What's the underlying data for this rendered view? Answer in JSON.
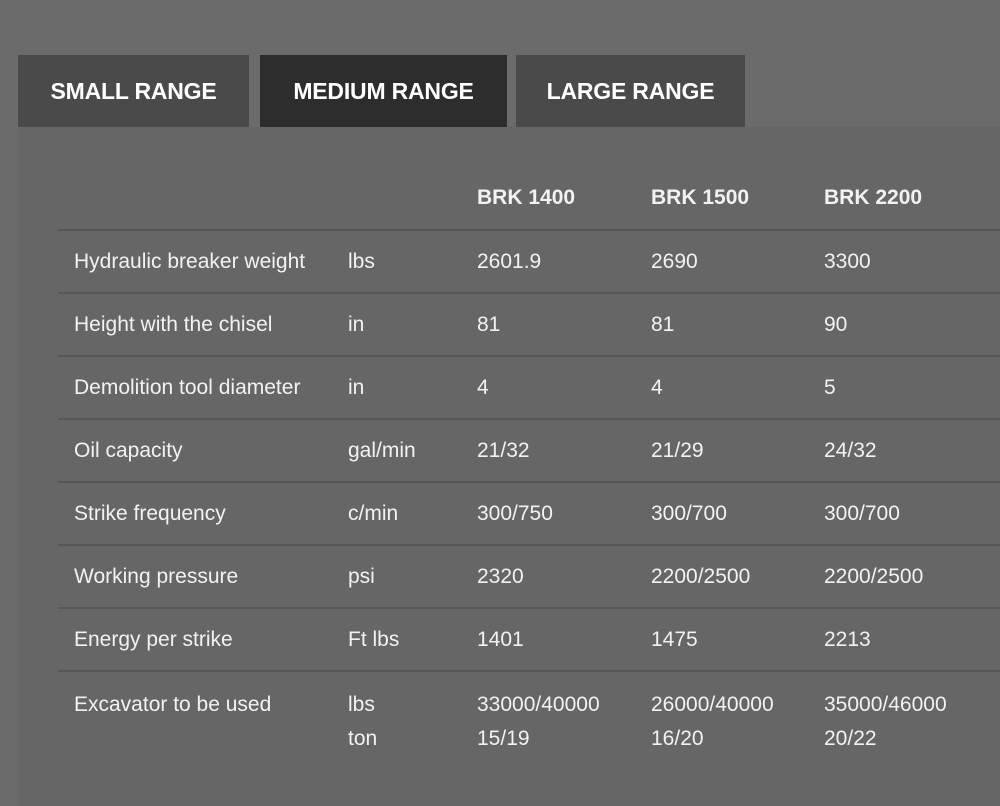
{
  "tabs": [
    {
      "label": "SMALL RANGE",
      "active": false
    },
    {
      "label": "MEDIUM RANGE",
      "active": true
    },
    {
      "label": "LARGE RANGE",
      "active": false
    }
  ],
  "table": {
    "models": [
      "BRK 1400",
      "BRK 1500",
      "BRK 2200"
    ],
    "rows": [
      {
        "param": "Hydraulic breaker weight",
        "unit": "lbs",
        "values": [
          "2601.9",
          "2690",
          "3300"
        ]
      },
      {
        "param": "Height with the chisel",
        "unit": "in",
        "values": [
          "81",
          "81",
          "90"
        ]
      },
      {
        "param": "Demolition tool diameter",
        "unit": "in",
        "values": [
          "4",
          "4",
          "5"
        ]
      },
      {
        "param": "Oil capacity",
        "unit": "gal/min",
        "values": [
          "21/32",
          "21/29",
          "24/32"
        ]
      },
      {
        "param": "Strike frequency",
        "unit": "c/min",
        "values": [
          "300/750",
          "300/700",
          "300/700"
        ]
      },
      {
        "param": "Working pressure",
        "unit": "psi",
        "values": [
          "2320",
          "2200/2500",
          "2200/2500"
        ]
      },
      {
        "param": "Energy per strike",
        "unit": "Ft lbs",
        "values": [
          "1401",
          "1475",
          "2213"
        ]
      }
    ],
    "last_row": {
      "param": "Excavator to be used",
      "units": [
        "lbs",
        "ton"
      ],
      "values": [
        [
          "33000/40000",
          "15/19"
        ],
        [
          "26000/40000",
          "16/20"
        ],
        [
          "35000/46000",
          "20/22"
        ]
      ]
    }
  }
}
